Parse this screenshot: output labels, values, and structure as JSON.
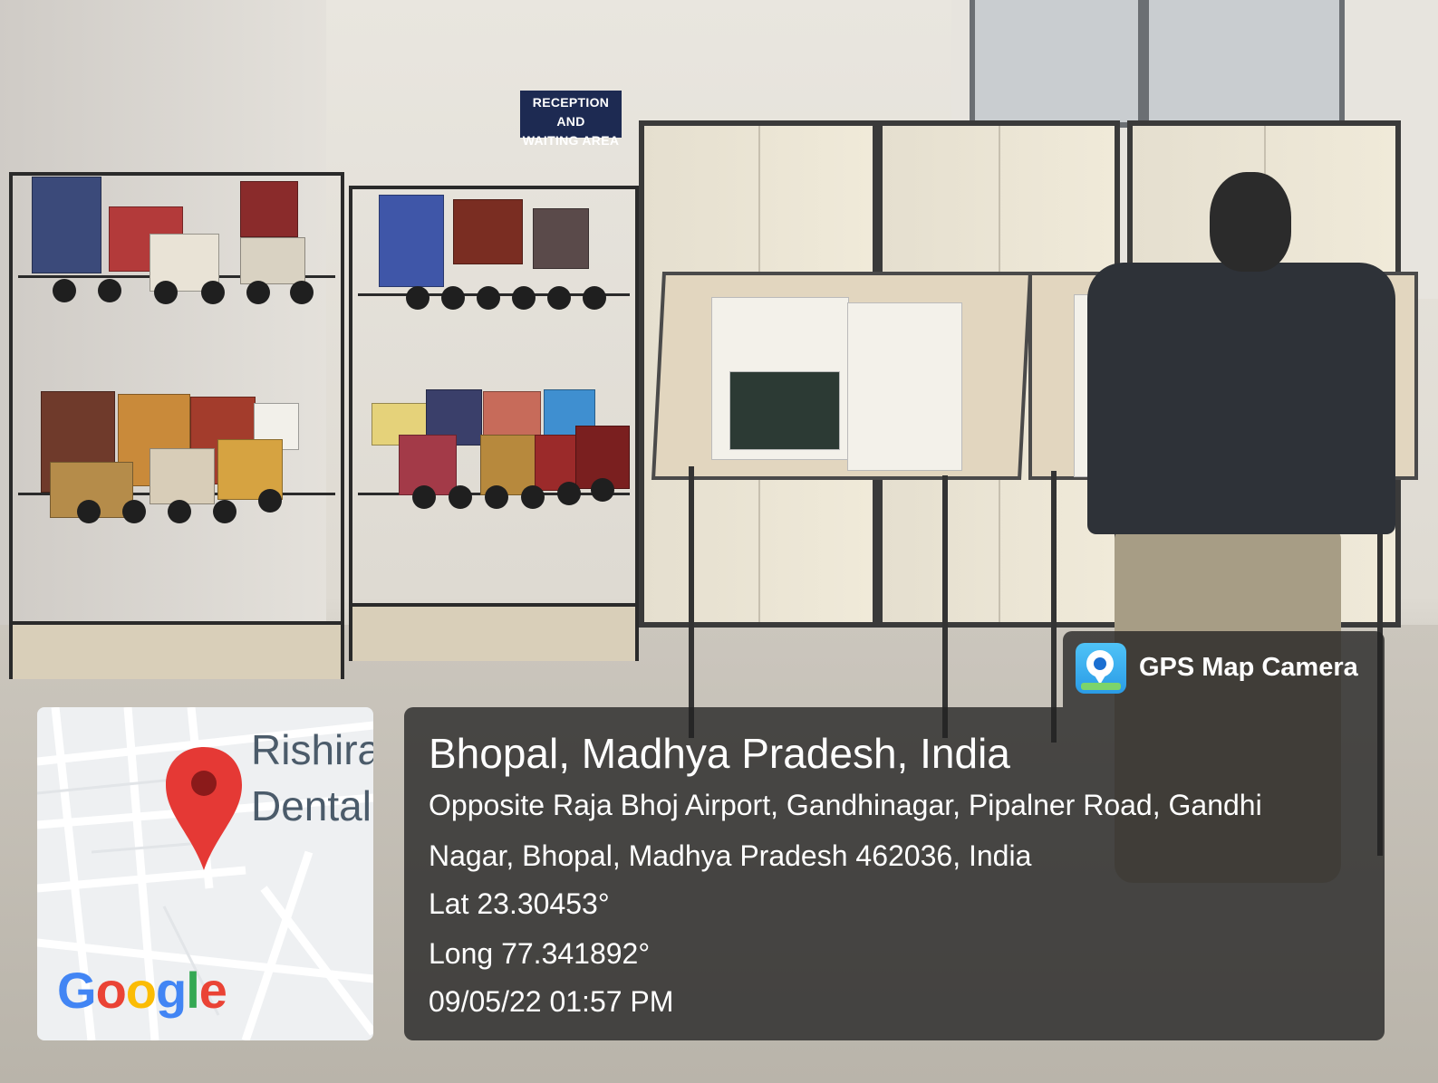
{
  "scene": {
    "sign_lines": [
      "RECEPTION AND",
      "WAITING AREA"
    ]
  },
  "map": {
    "label_line1": "Rishira",
    "label_line2": "Dental",
    "google_letters": [
      {
        "ch": "G",
        "color": "#4285F4"
      },
      {
        "ch": "o",
        "color": "#EA4335"
      },
      {
        "ch": "o",
        "color": "#FBBC05"
      },
      {
        "ch": "g",
        "color": "#4285F4"
      },
      {
        "ch": "l",
        "color": "#34A853"
      },
      {
        "ch": "e",
        "color": "#EA4335"
      }
    ],
    "pin_color": "#E53935"
  },
  "badge": {
    "icon": "gps-map-camera-icon",
    "label": "GPS Map Camera"
  },
  "location": {
    "title": "Bhopal, Madhya Pradesh, India",
    "address_line1": "Opposite Raja Bhoj Airport, Gandhinagar, Pipalner Road, Gandhi",
    "address_line2": "Nagar, Bhopal, Madhya Pradesh 462036, India",
    "lat": "Lat 23.30453°",
    "long": "Long 77.341892°",
    "datetime": "09/05/22 01:57 PM"
  }
}
